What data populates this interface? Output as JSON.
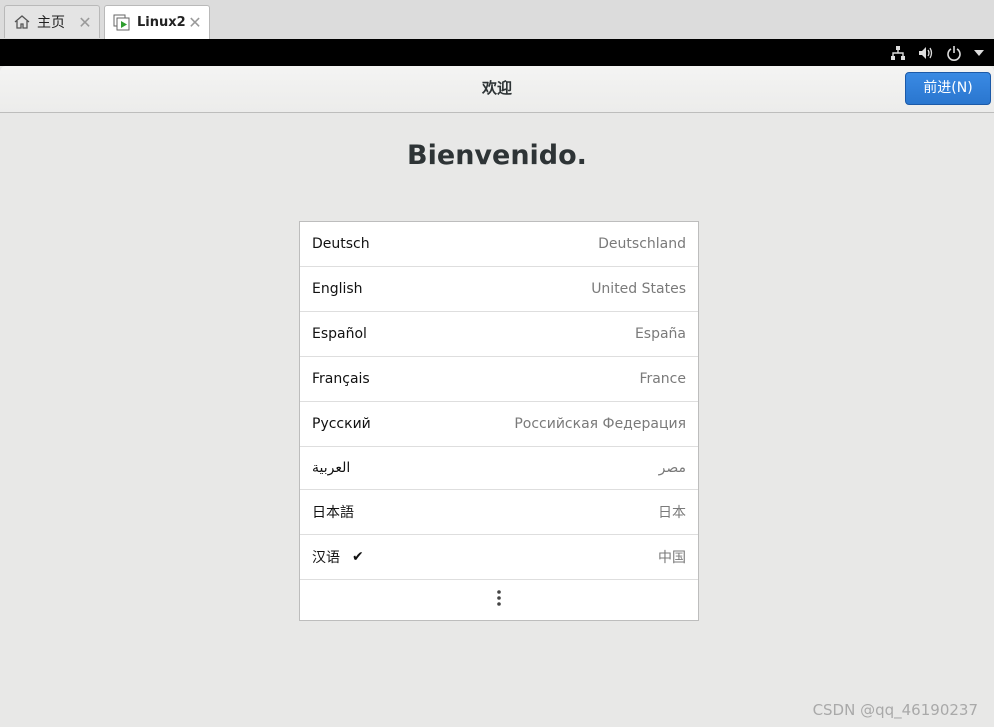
{
  "tabs": [
    {
      "label": "主页",
      "icon": "home-icon"
    },
    {
      "label": "Linux2",
      "icon": "vm-icon"
    }
  ],
  "topbar": {
    "icons": [
      "network-icon",
      "volume-icon",
      "power-icon",
      "dropdown-arrow-icon"
    ]
  },
  "header": {
    "title": "欢迎",
    "next_label": "前进(N)"
  },
  "welcome": "Bienvenido.",
  "languages": [
    {
      "name": "Deutsch",
      "region": "Deutschland"
    },
    {
      "name": "English",
      "region": "United States"
    },
    {
      "name": "Español",
      "region": "España"
    },
    {
      "name": "Français",
      "region": "France"
    },
    {
      "name": "Русский",
      "region": "Российская Федерация"
    },
    {
      "name": "العربية",
      "region": "مصر"
    },
    {
      "name": "日本語",
      "region": "日本"
    },
    {
      "name": "汉语",
      "region": "中国",
      "selected": true
    }
  ],
  "watermark": "CSDN @qq_46190237",
  "colors": {
    "accent": "#2a76cf",
    "background": "#e8e8e7"
  }
}
